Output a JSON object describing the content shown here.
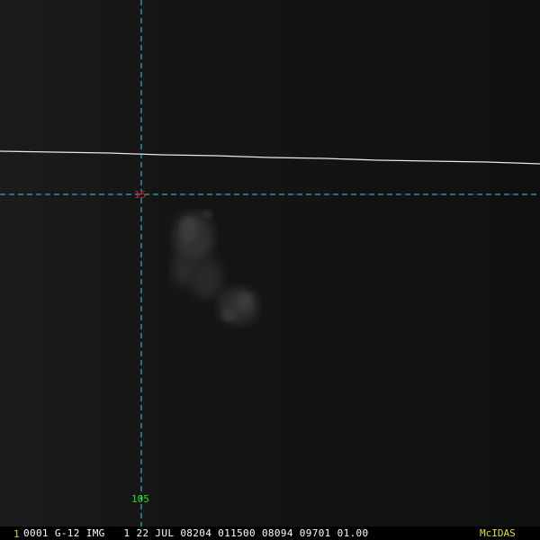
{
  "grid": {
    "latitude_label": "15",
    "longitude_label": "105",
    "line_color": "#2fd0e0",
    "latitude_label_color": "#e02020",
    "longitude_label_color": "#20e020"
  },
  "image": {
    "background_color": "#121212",
    "coastline_color": "#e8e8e8",
    "cloud_color": "#7a7a7a"
  },
  "status_bar": {
    "frame_number": "1",
    "header": "0001 G-12 IMG   1 22 JUL 08204 011500 08094 09701 01.00",
    "software": "McIDAS",
    "frame_number_color": "#e8d020",
    "header_color": "#ffffff",
    "software_color": "#e8e020"
  }
}
